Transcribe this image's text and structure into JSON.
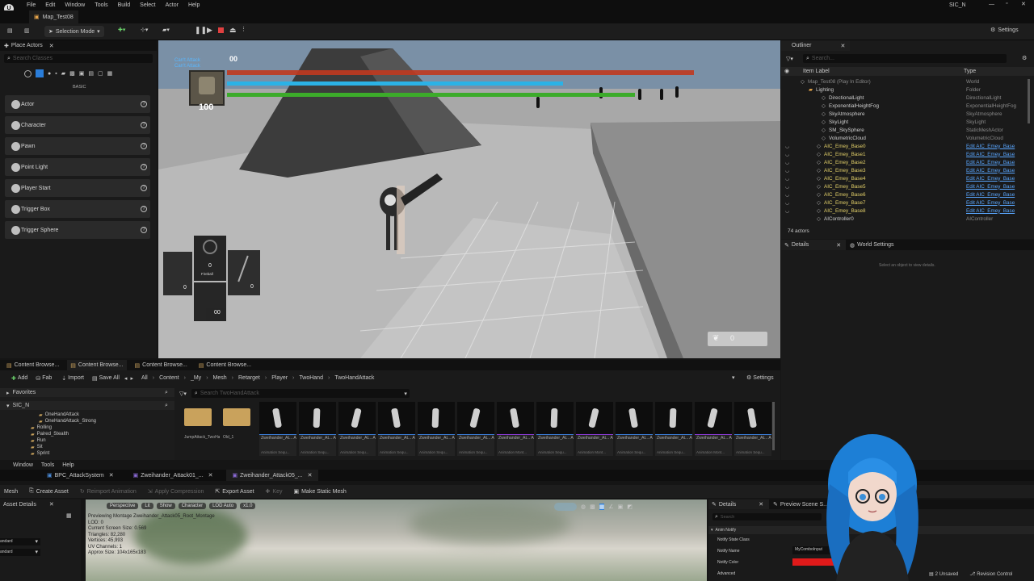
{
  "menu": [
    "File",
    "Edit",
    "Window",
    "Tools",
    "Build",
    "Select",
    "Actor",
    "Help"
  ],
  "project_name": "SIC_N",
  "map_tab": "Map_Test08",
  "toolbar": {
    "selection_mode": "Selection Mode",
    "settings": "Settings"
  },
  "place_actors": {
    "title": "Place Actors",
    "search_placeholder": "Search Classes",
    "category": "BASIC",
    "items": [
      "Actor",
      "Character",
      "Pawn",
      "Point Light",
      "Player Start",
      "Trigger Box",
      "Trigger Sphere"
    ]
  },
  "hud": {
    "top_number": "00",
    "debug_lines": [
      "Can't Attack",
      "Can't Attack"
    ],
    "health": "100",
    "skill_name": "Fireball",
    "skill_count": "0",
    "slot_left": "0",
    "slot_right": "0",
    "slot_bottom": "00",
    "score": "0"
  },
  "outliner": {
    "title": "Outliner",
    "search_placeholder": "Search...",
    "col_label": "Item Label",
    "col_type": "Type",
    "rows": [
      {
        "label": "Map_Test08 (Play In Editor)",
        "type": "World",
        "link": false
      },
      {
        "label": "Lighting",
        "type": "Folder",
        "link": false
      },
      {
        "label": "DirectionalLight",
        "type": "DirectionalLight",
        "link": false
      },
      {
        "label": "ExponentialHeightFog",
        "type": "ExponentialHeightFog",
        "link": false
      },
      {
        "label": "SkyAtmosphere",
        "type": "SkyAtmosphere",
        "link": false
      },
      {
        "label": "SkyLight",
        "type": "SkyLight",
        "link": false
      },
      {
        "label": "SM_SkySphere",
        "type": "StaticMeshActor",
        "link": false
      },
      {
        "label": "VolumetricCloud",
        "type": "VolumetricCloud",
        "link": false
      },
      {
        "label": "AIC_Emey_Base0",
        "type": "Edit AIC_Emey_Base",
        "link": true
      },
      {
        "label": "AIC_Emey_Base1",
        "type": "Edit AIC_Emey_Base",
        "link": true
      },
      {
        "label": "AIC_Emey_Base2",
        "type": "Edit AIC_Emey_Base",
        "link": true
      },
      {
        "label": "AIC_Emey_Base3",
        "type": "Edit AIC_Emey_Base",
        "link": true
      },
      {
        "label": "AIC_Emey_Base4",
        "type": "Edit AIC_Emey_Base",
        "link": true
      },
      {
        "label": "AIC_Emey_Base5",
        "type": "Edit AIC_Emey_Base",
        "link": true
      },
      {
        "label": "AIC_Emey_Base6",
        "type": "Edit AIC_Emey_Base",
        "link": true
      },
      {
        "label": "AIC_Emey_Base7",
        "type": "Edit AIC_Emey_Base",
        "link": true
      },
      {
        "label": "AIC_Emey_Base8",
        "type": "Edit AIC_Emey_Base",
        "link": true
      },
      {
        "label": "AIController0",
        "type": "AIController",
        "link": false
      }
    ],
    "actor_count": "74 actors"
  },
  "details": {
    "tab": "Details",
    "tab2": "World Settings",
    "empty": "Select an object to view details."
  },
  "content_browser": {
    "tabs": [
      "Content Browse...",
      "Content Browse...",
      "Content Browse...",
      "Content Browse..."
    ],
    "add": "Add",
    "fab": "Fab",
    "import": "Import",
    "save_all": "Save All",
    "path": [
      "All",
      "Content",
      "_My",
      "Mesh",
      "Retarget",
      "Player",
      "TwoHand",
      "TwoHandAttack"
    ],
    "settings": "Settings",
    "favorites": "Favorites",
    "root": "SIC_N",
    "tree": [
      "OneHandAttack",
      "OneHandAttack_Strong",
      "Rolling",
      "Paired_Stealth",
      "Run",
      "Sit",
      "Sprint"
    ],
    "search_placeholder": "Search TwoHandAttack",
    "folders": [
      {
        "name": "JumpAttack_TwoHands"
      },
      {
        "name": "Old_1"
      }
    ],
    "assets": [
      {
        "name": "Zweihander_At... Attack01_1...",
        "sub": "Animation Sequ..."
      },
      {
        "name": "Zweihander_At... Attack01_2_ALL",
        "sub": "Animation Sequ..."
      },
      {
        "name": "Zweihander_At... Attack02_1...",
        "sub": "Animation Sequ..."
      },
      {
        "name": "Zweihander_At... Attack02_End...",
        "sub": "Animation Sequ..."
      },
      {
        "name": "Zweihander_At... Attack02_Loop...",
        "sub": "Animation Sequ..."
      },
      {
        "name": "Zweihander_At... Attack02_Start...",
        "sub": "Animation Sequ..."
      },
      {
        "name": "Zweihander_At... Attack02_Start...",
        "sub": "Animation Mont..."
      },
      {
        "name": "Zweihander_At... Attack01_1...",
        "sub": "Animation Sequ..."
      },
      {
        "name": "Zweihander_At... Attack01_1...",
        "sub": "Animation Mont..."
      },
      {
        "name": "Zweihander_At... Attack01_2_ALL",
        "sub": "Animation Sequ..."
      },
      {
        "name": "Zweihander_At... Attack01_2...",
        "sub": "Animation Sequ..."
      },
      {
        "name": "Zweihander_At... Attack01_2...",
        "sub": "Animation Mont..."
      },
      {
        "name": "Zweihander_At... Attack01_3_ALL",
        "sub": "Animation Sequ..."
      }
    ]
  },
  "anim_editor": {
    "menu": [
      "Window",
      "Tools",
      "Help"
    ],
    "tabs": [
      "BPC_AttackSystem",
      "Zweihander_Attack01_...",
      "Zweihander_Attack05_..."
    ],
    "toolbar": [
      "Mesh",
      "Create Asset",
      "Reimport Animation",
      "Apply Compression",
      "Export Asset",
      "Key",
      "Make Static Mesh"
    ],
    "asset_details": "Asset Details",
    "dropdowns": [
      "andard",
      "andard"
    ],
    "viewport_buttons": [
      "Perspective",
      "Lit",
      "Show",
      "Character",
      "LOD Auto",
      "x1.0"
    ],
    "stats": [
      "Previewing Montage Zweihander_Attack05_Root_Montage",
      "LOD: 0",
      "Current Screen Size: 0.569",
      "Triangles: 82,280",
      "Vertices: 45,993",
      "UV Channels: 1",
      "Approx Size: 104x165x183"
    ],
    "details_tab": "Details",
    "preview_tab": "Preview Scene S...",
    "search_placeholder": "Search",
    "section": "Anim Notify",
    "fields": [
      "Notify State Class",
      "Notify Name",
      "Notify Color",
      "Advanced"
    ],
    "notify_name_value": "MyComboInput"
  },
  "status": {
    "unsaved": "2 Unsaved",
    "revision": "Revision Control"
  },
  "colors": {
    "health": "#c0391f",
    "mana": "#2bb2e6",
    "stamina": "#3cab2a",
    "link": "#5aa7ff",
    "accent": "#2a7dd9"
  }
}
